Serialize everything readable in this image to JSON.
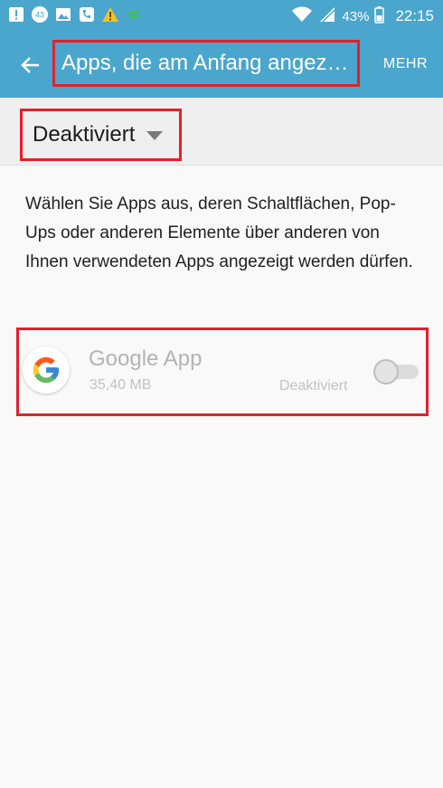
{
  "status_bar": {
    "notification_badge": "43",
    "battery": "43%",
    "time": "22:15",
    "icons": [
      "alert-icon",
      "badge-43-icon",
      "image-icon",
      "voicemail-icon",
      "warning-icon",
      "transfer-icon",
      "wifi-icon",
      "signal-icon",
      "battery-icon"
    ]
  },
  "app_bar": {
    "title": "Apps, die am Anfang angezeigt werden dürfen",
    "more_label": "MEHR",
    "color": "#4aa6cd"
  },
  "filter": {
    "selected": "Deaktiviert"
  },
  "description": "Wählen Sie Apps aus, deren Schaltflächen, Pop-Ups oder anderen Elemente über anderen von Ihnen verwendeten Apps angezeigt werden dürfen.",
  "apps": [
    {
      "name": "Google App",
      "size": "35,40 MB",
      "status": "Deaktiviert",
      "enabled": false,
      "icon": "google-g-icon"
    }
  ],
  "highlight_color": "#e3202b"
}
